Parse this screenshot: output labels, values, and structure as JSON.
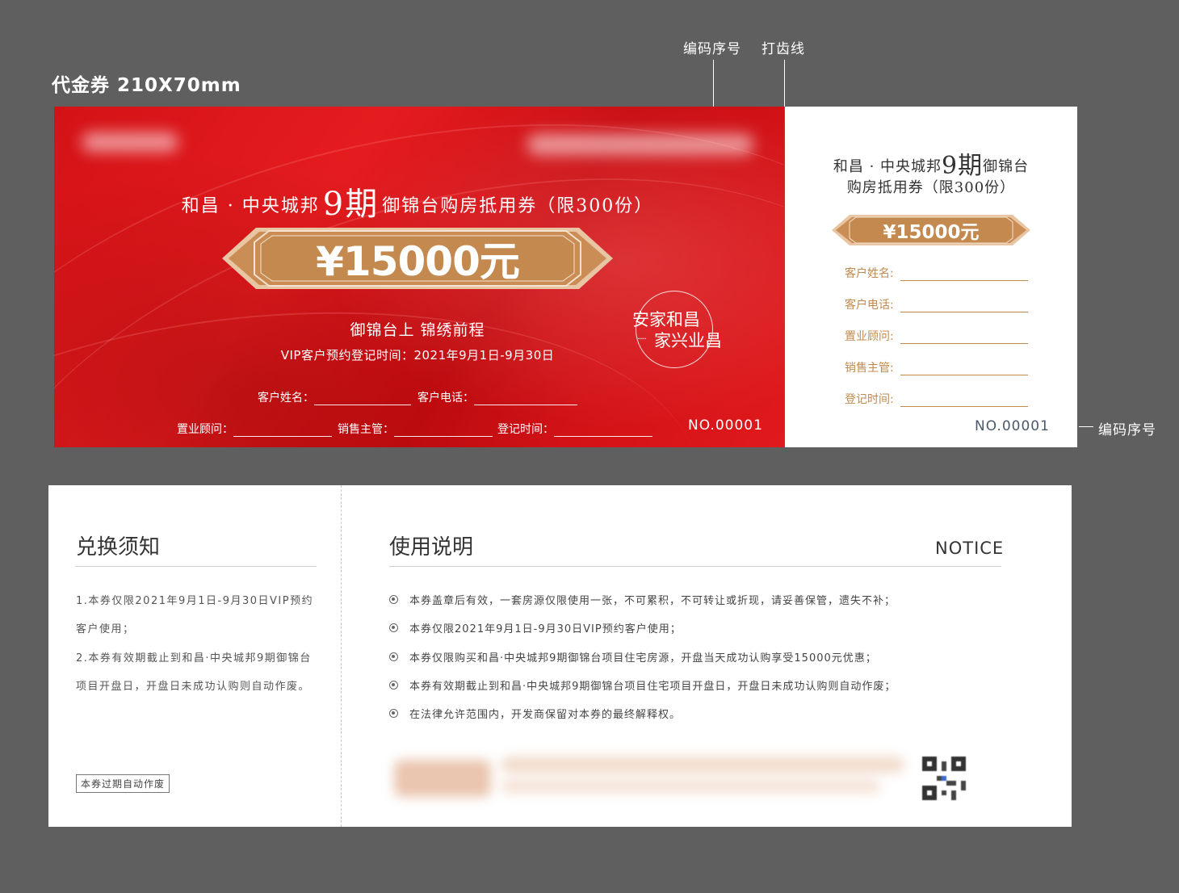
{
  "headline": "代金券  210X70mm",
  "annotations": {
    "serial": "编码序号",
    "perforation": "打齿线",
    "serial_right": "编码序号"
  },
  "front": {
    "title_pre": "和昌 · 中央城邦",
    "title_big": "9期",
    "title_post": "御锦台购房抵用券（限300份）",
    "amount": "¥15000元",
    "slogan": "御锦台上 锦绣前程",
    "vip_time": "VIP客户预约登记时间：2021年9月1日-9月30日",
    "fields_row1": [
      "客户姓名：",
      "客户电话："
    ],
    "fields_row2": [
      "置业顾问：",
      "销售主管：",
      "登记时间："
    ],
    "serial_no": "NO.00001",
    "badge_line1": "安家和昌",
    "badge_line2": "家兴业昌"
  },
  "stub": {
    "title_l1_pre": "和昌 · 中央城邦",
    "title_l1_big": "9期",
    "title_l1_post": "御锦台",
    "title_l2": "购房抵用券（限300份）",
    "amount": "¥15000元",
    "fields": [
      "客户姓名:",
      "客户电话:",
      "置业顾问:",
      "销售主管:",
      "登记时间:"
    ],
    "serial_no": "NO.00001"
  },
  "back": {
    "exchange_heading": "兑换须知",
    "exchange_lines": [
      "1.本券仅限2021年9月1日-9月30日VIP预约",
      "客户使用；",
      "2.本券有效期截止到和昌·中央城邦9期御锦台",
      "项目开盘日，开盘日未成功认购则自动作废。"
    ],
    "expire_note": "本券过期自动作废",
    "usage_heading": "使用说明",
    "notice": "NOTICE",
    "usage_items": [
      "本券盖章后有效，一套房源仅限使用一张，不可累积，不可转让或折现，请妥善保管，遗失不补；",
      "本券仅限2021年9月1日-9月30日VIP预约客户使用；",
      "本券仅限购买和昌·中央城邦9期御锦台项目住宅房源，开盘当天成功认购享受15000元优惠；",
      "本券有效期截止到和昌·中央城邦9期御锦台项目住宅项目开盘日，开盘日未成功认购则自动作废；",
      "在法律允许范围内，开发商保留对本券的最终解释权。"
    ]
  },
  "colors": {
    "red": "#d9161a",
    "gold": "#c08a4e",
    "background": "#5f5f5f"
  }
}
